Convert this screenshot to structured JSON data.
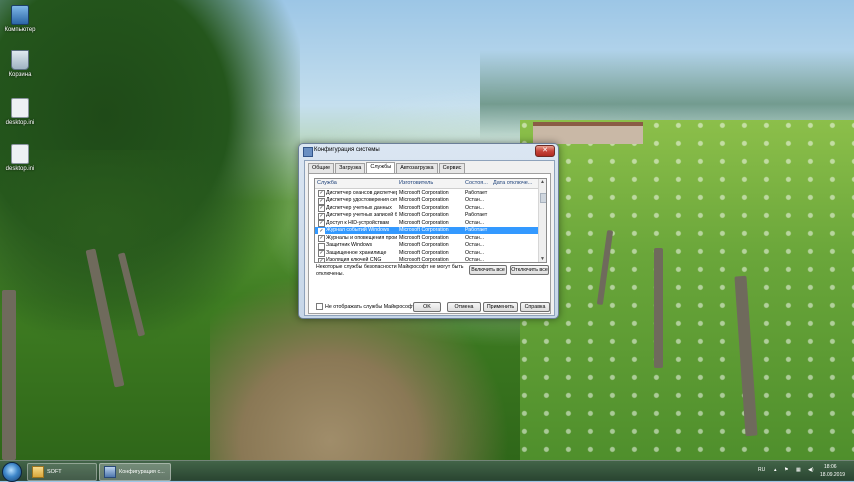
{
  "desktop": {
    "icons": [
      {
        "label": "Компьютер",
        "icon": "computer-icon"
      },
      {
        "label": "Корзина",
        "icon": "recycle-bin-icon"
      },
      {
        "label": "desktop.ini",
        "icon": "file-icon"
      },
      {
        "label": "desktop.ini",
        "icon": "file-icon"
      }
    ]
  },
  "window": {
    "title": "Конфигурация системы",
    "close_glyph": "✕",
    "tabs": [
      "Общие",
      "Загрузка",
      "Службы",
      "Автозагрузка",
      "Сервис"
    ],
    "active_tab": "Службы",
    "columns": [
      "Служба",
      "Изготовитель",
      "Состоя...",
      "Дата отключе..."
    ],
    "rows": [
      {
        "service": "Диспетчер сеансов диспетчер...",
        "maker": "Microsoft Corporation",
        "state": "Работает",
        "checked": true
      },
      {
        "service": "Диспетчер удостоверения сет...",
        "maker": "Microsoft Corporation",
        "state": "Остан...",
        "checked": true
      },
      {
        "service": "Диспетчер учетных данных",
        "maker": "Microsoft Corporation",
        "state": "Остан...",
        "checked": true
      },
      {
        "service": "Диспетчер учетных записей б...",
        "maker": "Microsoft Corporation",
        "state": "Работает",
        "checked": true
      },
      {
        "service": "Доступ к HID-устройствам",
        "maker": "Microsoft Corporation",
        "state": "Остан...",
        "checked": true
      },
      {
        "service": "Журнал событий Windows",
        "maker": "Microsoft Corporation",
        "state": "Работает",
        "checked": true,
        "selected": true
      },
      {
        "service": "Журналы и оповещения произ...",
        "maker": "Microsoft Corporation",
        "state": "Остан...",
        "checked": true
      },
      {
        "service": "Защитник Windows",
        "maker": "Microsoft Corporation",
        "state": "Остан...",
        "checked": false
      },
      {
        "service": "Защищенное хранилище",
        "maker": "Microsoft Corporation",
        "state": "Остан...",
        "checked": true
      },
      {
        "service": "Изоляция ключей CNG",
        "maker": "Microsoft Corporation",
        "state": "Остан...",
        "checked": true
      },
      {
        "service": "Инструментарий управления ...",
        "maker": "Microsoft Corporation",
        "state": "Работает",
        "checked": true
      }
    ],
    "check_glyph": "✓",
    "note": "Некоторые службы безопасности Майкрософт не могут быть отключены.",
    "enable_all": "Включить все",
    "disable_all": "Отключить все",
    "hide_ms": "Не отображать службы Майкрософт",
    "ok": "OK",
    "cancel": "Отмена",
    "apply": "Применить",
    "help": "Справка"
  },
  "taskbar": {
    "items": [
      {
        "label": "SOFT",
        "icon": "folder-icon"
      },
      {
        "label": "Конфигурация с...",
        "icon": "msconfig-icon"
      }
    ],
    "lang": "RU",
    "time": "18:06",
    "date": "18.09.2019"
  },
  "colors": {
    "selection": "#3399ff",
    "close": "#c7443a"
  }
}
